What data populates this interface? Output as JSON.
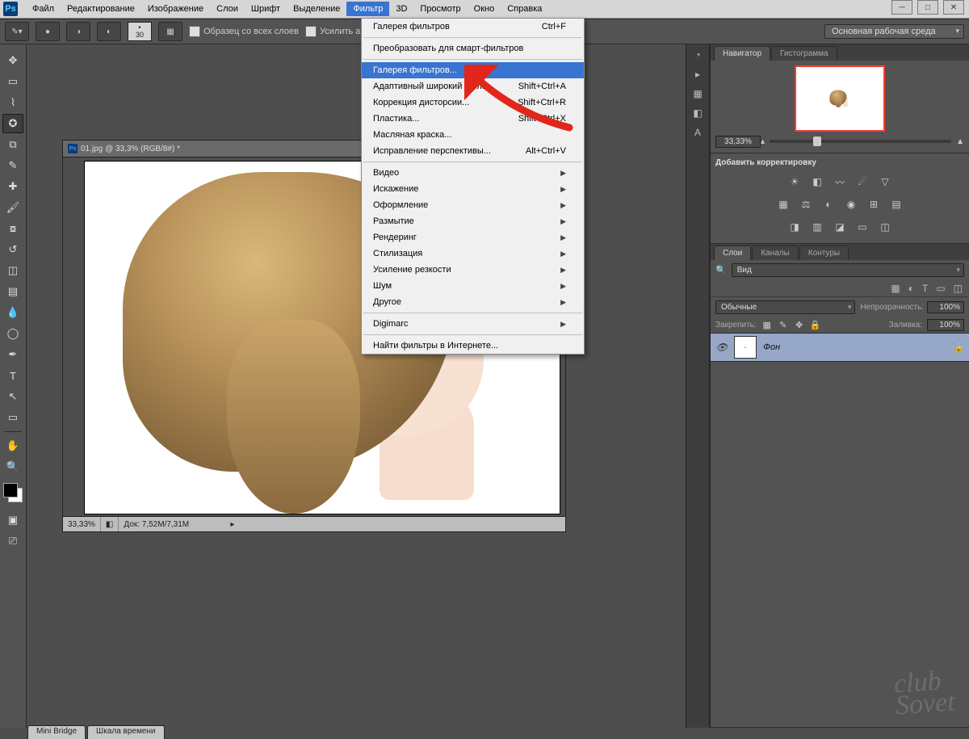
{
  "menubar": {
    "items": [
      "Файл",
      "Редактирование",
      "Изображение",
      "Слои",
      "Шрифт",
      "Выделение",
      "Фильтр",
      "3D",
      "Просмотр",
      "Окно",
      "Справка"
    ],
    "active_index": 6
  },
  "options_bar": {
    "brush_size": "30",
    "sample_all": "Образец со всех слоев",
    "auto_enhance": "Усилить автоматически",
    "workspace": "Основная рабочая среда"
  },
  "document": {
    "title": "01.jpg @ 33,3% (RGB/8#) *",
    "zoom": "33,33%",
    "doc_size": "Док: 7,52M/7,31M"
  },
  "dropdown": {
    "groups": [
      [
        {
          "label": "Галерея фильтров",
          "shortcut": "Ctrl+F"
        }
      ],
      [
        {
          "label": "Преобразовать для смарт-фильтров",
          "shortcut": ""
        }
      ],
      [
        {
          "label": "Галерея фильтров...",
          "shortcut": "",
          "highlight": true
        },
        {
          "label": "Адаптивный широкий угол...",
          "shortcut": "Shift+Ctrl+A"
        },
        {
          "label": "Коррекция дисторсии...",
          "shortcut": "Shift+Ctrl+R"
        },
        {
          "label": "Пластика...",
          "shortcut": "Shift+Ctrl+X"
        },
        {
          "label": "Масляная краска...",
          "shortcut": ""
        },
        {
          "label": "Исправление перспективы...",
          "shortcut": "Alt+Ctrl+V"
        }
      ],
      [
        {
          "label": "Видео",
          "submenu": true
        },
        {
          "label": "Искажение",
          "submenu": true
        },
        {
          "label": "Оформление",
          "submenu": true
        },
        {
          "label": "Размытие",
          "submenu": true
        },
        {
          "label": "Рендеринг",
          "submenu": true
        },
        {
          "label": "Стилизация",
          "submenu": true
        },
        {
          "label": "Усиление резкости",
          "submenu": true
        },
        {
          "label": "Шум",
          "submenu": true
        },
        {
          "label": "Другое",
          "submenu": true
        }
      ],
      [
        {
          "label": "Digimarc",
          "submenu": true
        }
      ],
      [
        {
          "label": "Найти фильтры в Интернете...",
          "shortcut": ""
        }
      ]
    ]
  },
  "panels": {
    "navigator": {
      "tab1": "Навигатор",
      "tab2": "Гистограмма",
      "zoom": "33,33%"
    },
    "adjustments": {
      "title": "Добавить корректировку"
    },
    "layers": {
      "tabs": [
        "Слои",
        "Каналы",
        "Контуры"
      ],
      "filter_label": "Вид",
      "blend_mode": "Обычные",
      "opacity_label": "Непрозрачность:",
      "opacity_value": "100%",
      "lock_label": "Закрепить:",
      "fill_label": "Заливка:",
      "fill_value": "100%",
      "layer_name": "Фон"
    }
  },
  "bottom_tabs": [
    "Mini Bridge",
    "Шкала времени"
  ],
  "watermark": "club\nSovet"
}
